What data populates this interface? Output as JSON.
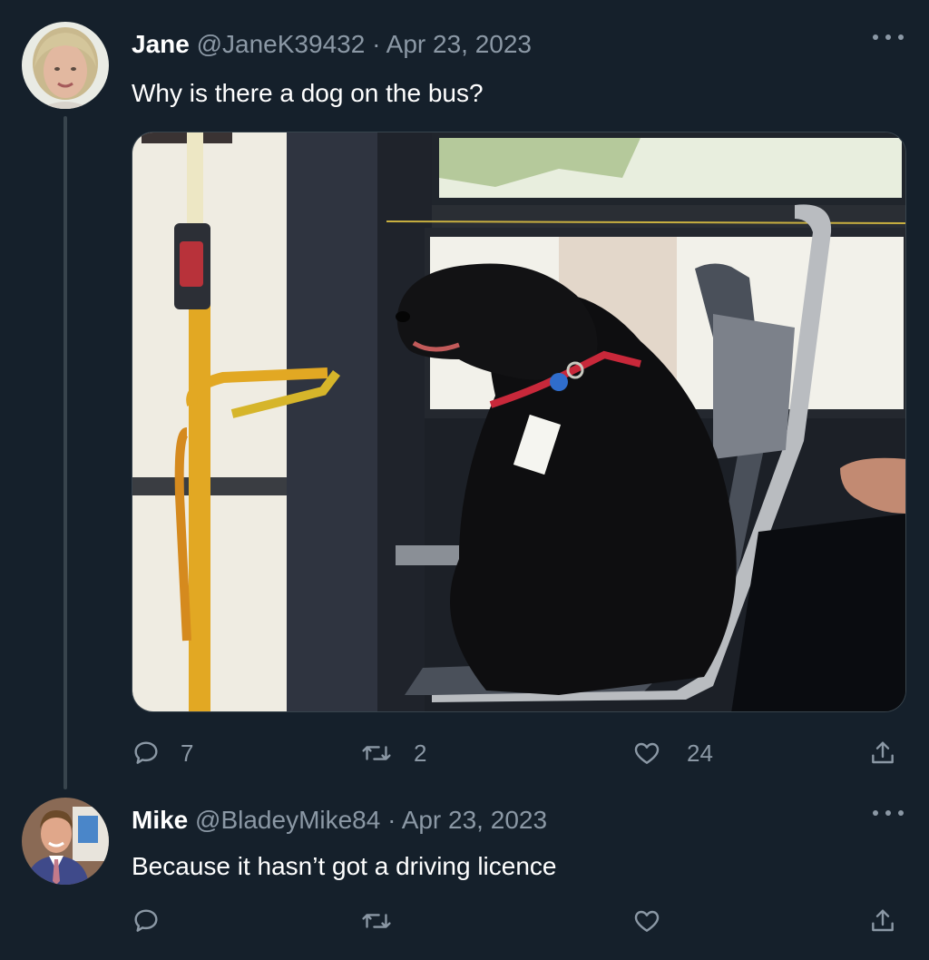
{
  "tweets": [
    {
      "name": "Jane",
      "handle": "@JaneK39432",
      "separator": "·",
      "date": "Apr 23, 2023",
      "text": "Why is there a dog on the bus?",
      "has_media": true,
      "media_alt_icon": "photo-black-dog-on-bus",
      "replies": "7",
      "retweets": "2",
      "likes": "24"
    },
    {
      "name": "Mike",
      "handle": "@BladeyMike84",
      "separator": "·",
      "date": "Apr 23, 2023",
      "text": "Because it hasn’t got a driving licence",
      "has_media": false,
      "replies": "",
      "retweets": "",
      "likes": ""
    }
  ],
  "icons": {
    "reply": "reply-icon",
    "retweet": "retweet-icon",
    "like": "heart-icon",
    "share": "share-icon",
    "more": "more-icon"
  },
  "colors": {
    "background": "#15202b",
    "text": "#ffffff",
    "muted": "#8b98a5",
    "thread_line": "#38444d"
  }
}
